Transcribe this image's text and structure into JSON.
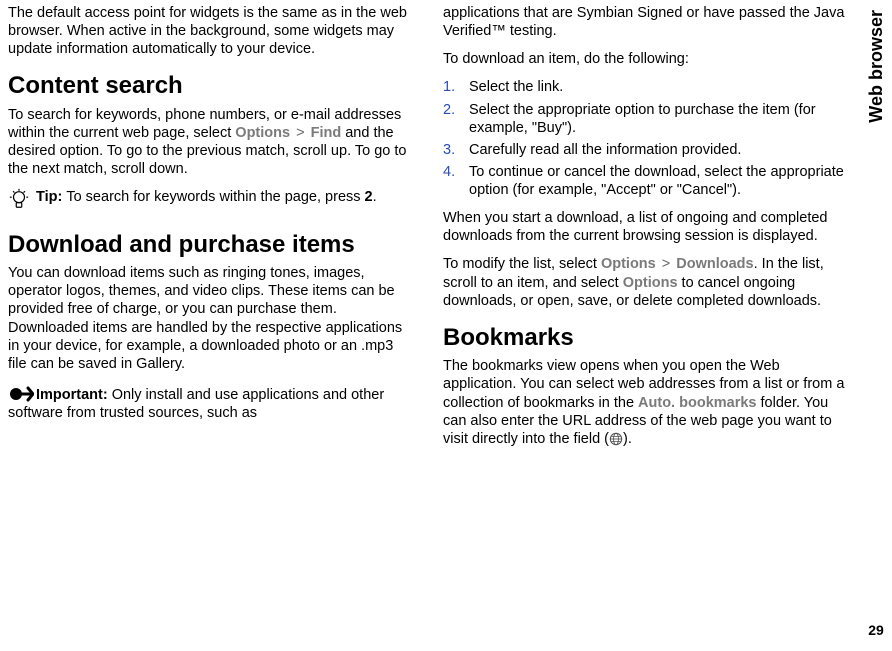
{
  "sidebar": {
    "label": "Web browser",
    "page_num": "29"
  },
  "left": {
    "p1": "The default access point for widgets is the same as in the web browser. When active in the background, some widgets may update information automatically to your device.",
    "h1": "Content search",
    "p2a": "To search for keywords, phone numbers, or e-mail addresses within the current web page, select ",
    "opt1": "Options",
    "find": "Find",
    "p2b": " and the desired option. To go to the previous match, scroll up. To go to the next match, scroll down.",
    "tip_label": "Tip: ",
    "tip_a": "To search for keywords within the page, press ",
    "tip_key": "2",
    "tip_b": ".",
    "h2": "Download and purchase items",
    "p3": "You can download items such as ringing tones, images, operator logos, themes, and video clips. These items can be provided free of charge, or you can purchase them. Downloaded items are handled by the respective applications in your device, for example, a downloaded photo or an .mp3 file can be saved in Gallery.",
    "imp_label": "Important:  ",
    "imp_text": "Only install and use applications and other software from trusted sources, such as "
  },
  "right": {
    "p1": "applications that are Symbian Signed or have passed the Java Verified™ testing.",
    "p2": "To download an item, do the following:",
    "li1": "Select the link.",
    "li2": "Select the appropriate option to purchase the item (for example, \"Buy\").",
    "li3": "Carefully read all the information provided.",
    "li4": "To continue or cancel the download, select the appropriate option (for example, \"Accept\" or \"Cancel\").",
    "p3": "When you start a download, a list of ongoing and completed downloads from the current browsing session is displayed.",
    "p4a": "To modify the list, select ",
    "opt1": "Options",
    "dl": "Downloads",
    "p4b": ". In the list, scroll to an item, and select ",
    "opt2": "Options",
    "p4c": " to cancel ongoing downloads, or open, save, or delete completed downloads.",
    "h1": "Bookmarks",
    "p5a": "The bookmarks view opens when you open the Web application. You can select web addresses from a list or from a collection of bookmarks in the ",
    "autobm": "Auto. bookmarks",
    "p5b": " folder. You can also enter the URL address of the web page you want to visit directly into the field (",
    "p5c": ")."
  },
  "gt": ">"
}
